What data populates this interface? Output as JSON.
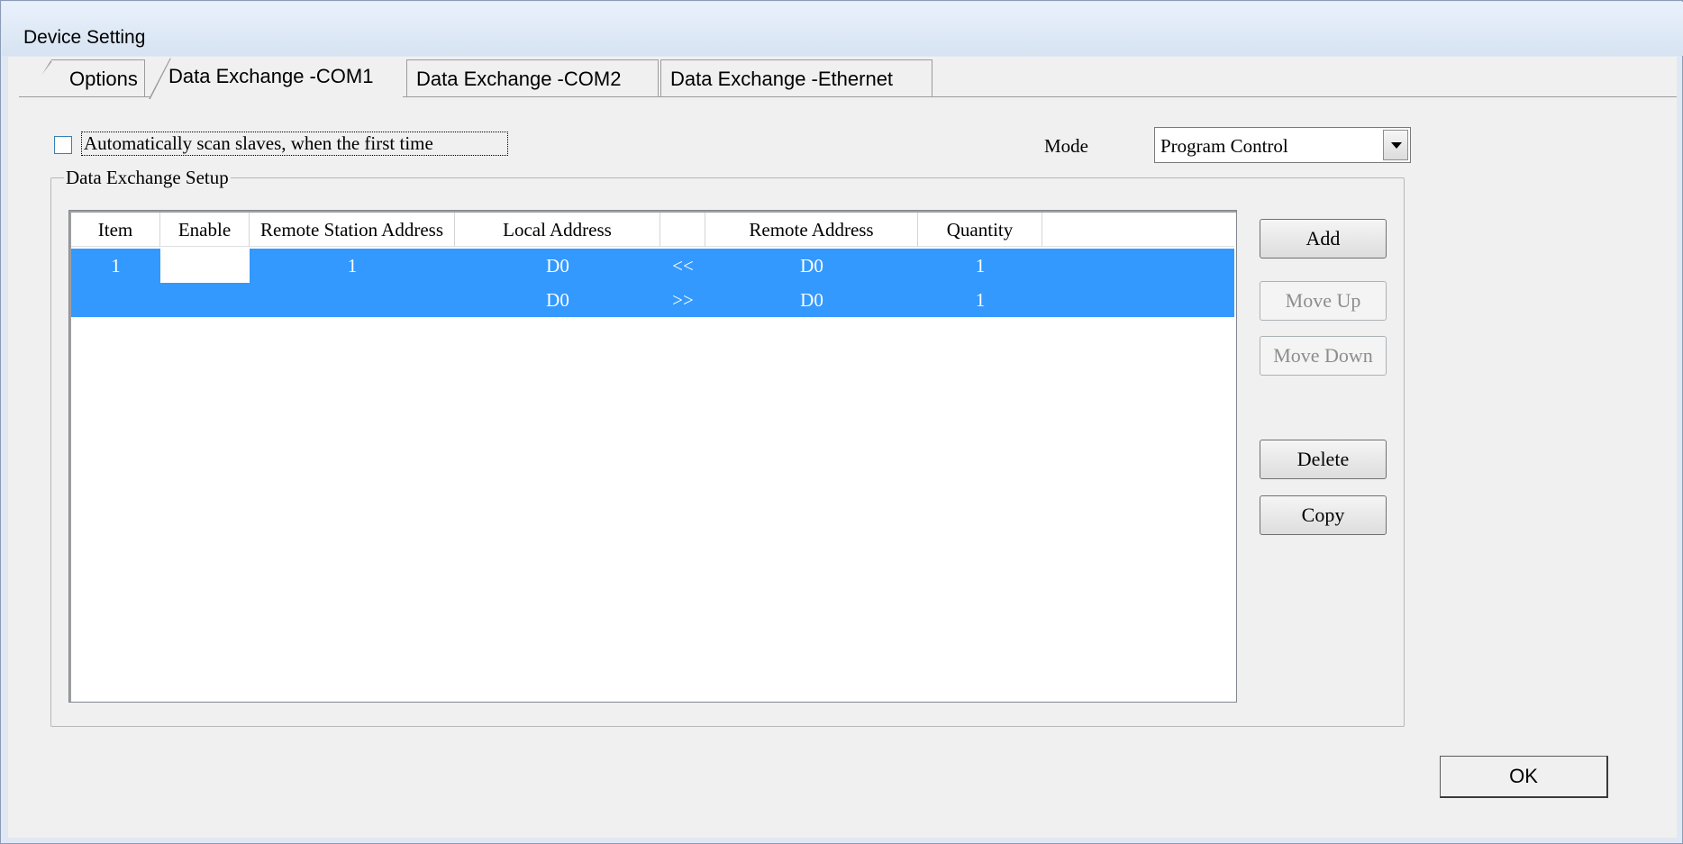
{
  "window": {
    "title": "Device Setting"
  },
  "tabs": [
    {
      "label": "Options"
    },
    {
      "label": "Data Exchange -COM1",
      "active": true
    },
    {
      "label": "Data Exchange -COM2"
    },
    {
      "label": "Data Exchange -Ethernet"
    }
  ],
  "auto_scan": {
    "label": "Automatically scan slaves, when the first time",
    "checked": false
  },
  "mode": {
    "label": "Mode",
    "value": "Program Control"
  },
  "group": {
    "title": "Data Exchange Setup"
  },
  "table": {
    "columns": [
      "Item",
      "Enable",
      "Remote Station Address",
      "Local Address",
      "",
      "Remote Address",
      "Quantity"
    ],
    "rows": [
      {
        "item": "1",
        "enable": "",
        "remote_station": "1",
        "local": "D0",
        "direction": "<<",
        "remote": "D0",
        "quantity": "1"
      },
      {
        "item": "",
        "enable": "",
        "remote_station": "",
        "local": "D0",
        "direction": ">>",
        "remote": "D0",
        "quantity": "1"
      }
    ]
  },
  "buttons": {
    "add": "Add",
    "move_up": "Move Up",
    "move_down": "Move Down",
    "delete": "Delete",
    "copy": "Copy",
    "ok": "OK"
  },
  "colors": {
    "selection": "#3399ff",
    "window_frame": "#dfe8f3",
    "client_bg": "#f0f0f0"
  }
}
